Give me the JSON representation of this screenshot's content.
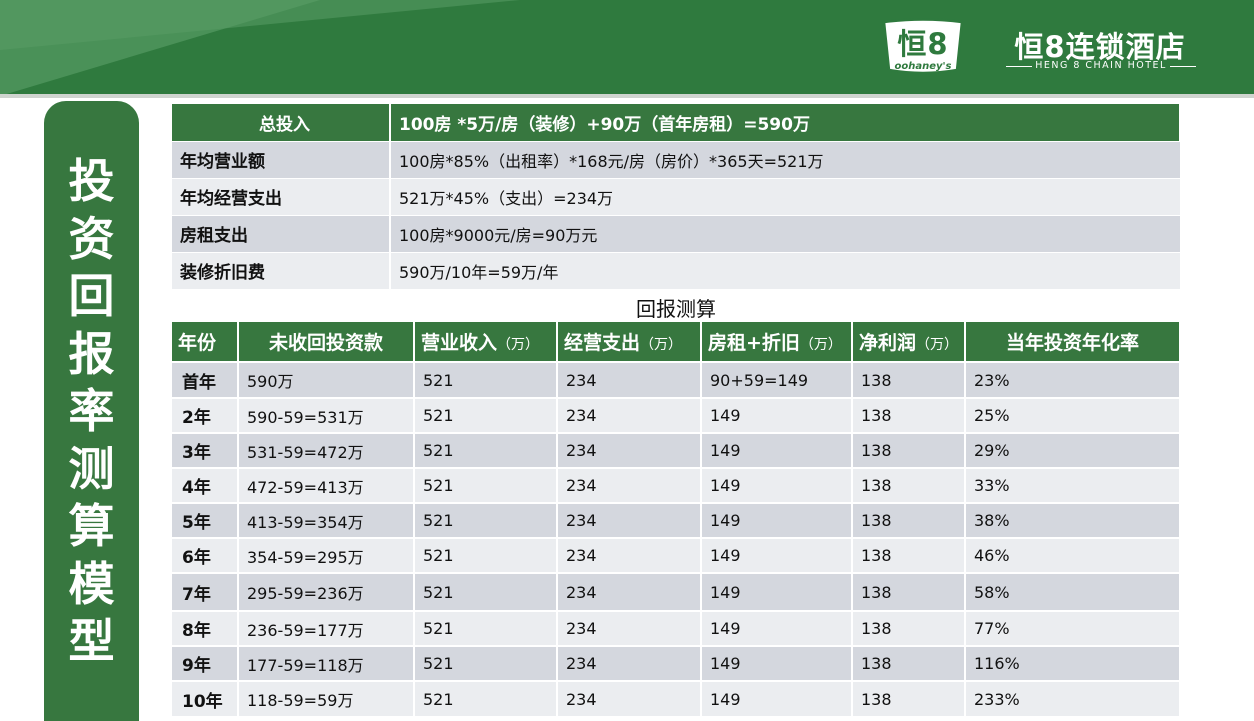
{
  "brand": {
    "badge_text": "恒8",
    "badge_sub": "oohaney's",
    "name_cn": "恒8连锁酒店",
    "name_en": "HENG 8 CHAIN HOTEL",
    "colors": {
      "green": "#37773f",
      "banner": "#2f7a3e"
    }
  },
  "sidebar": {
    "title_chars": [
      "投",
      "资",
      "回",
      "报",
      "率",
      "测",
      "算",
      "模",
      "型"
    ]
  },
  "summary": {
    "header": {
      "label": "总投入",
      "value": "100房 *5万/房（装修）+90万（首年房租）=590万"
    },
    "rows": [
      {
        "label": "年均营业额",
        "value": "100房*85%（出租率）*168元/房（房价）*365天=521万"
      },
      {
        "label": "年均经营支出",
        "value": "521万*45%（支出）=234万"
      },
      {
        "label": "房租支出",
        "value": "100房*9000元/房=90万元"
      },
      {
        "label": "装修折旧费",
        "value": "590万/10年=59万/年"
      }
    ]
  },
  "returns": {
    "caption": "回报测算",
    "headers": [
      {
        "main": "年份",
        "unit": ""
      },
      {
        "main": "未收回投资款",
        "unit": ""
      },
      {
        "main": "营业收入",
        "unit": "（万）"
      },
      {
        "main": "经营支出",
        "unit": "（万）"
      },
      {
        "main": "房租+折旧",
        "unit": "（万）"
      },
      {
        "main": "净利润",
        "unit": "（万）"
      },
      {
        "main": "当年投资年化率",
        "unit": ""
      }
    ],
    "rows": [
      [
        "首年",
        "590万",
        "521",
        "234",
        "90+59=149",
        "138",
        "23%"
      ],
      [
        "2年",
        "590-59=531万",
        "521",
        "234",
        "149",
        "138",
        "25%"
      ],
      [
        "3年",
        "531-59=472万",
        "521",
        "234",
        "149",
        "138",
        "29%"
      ],
      [
        "4年",
        "472-59=413万",
        "521",
        "234",
        "149",
        "138",
        "33%"
      ],
      [
        "5年",
        "413-59=354万",
        "521",
        "234",
        "149",
        "138",
        "38%"
      ],
      [
        "6年",
        "354-59=295万",
        "521",
        "234",
        "149",
        "138",
        "46%"
      ],
      [
        "7年",
        "295-59=236万",
        "521",
        "234",
        "149",
        "138",
        "58%"
      ],
      [
        "8年",
        "236-59=177万",
        "521",
        "234",
        "149",
        "138",
        "77%"
      ],
      [
        "9年",
        "177-59=118万",
        "521",
        "234",
        "149",
        "138",
        "116%"
      ],
      [
        "10年",
        "118-59=59万",
        "521",
        "234",
        "149",
        "138",
        "233%"
      ]
    ]
  }
}
